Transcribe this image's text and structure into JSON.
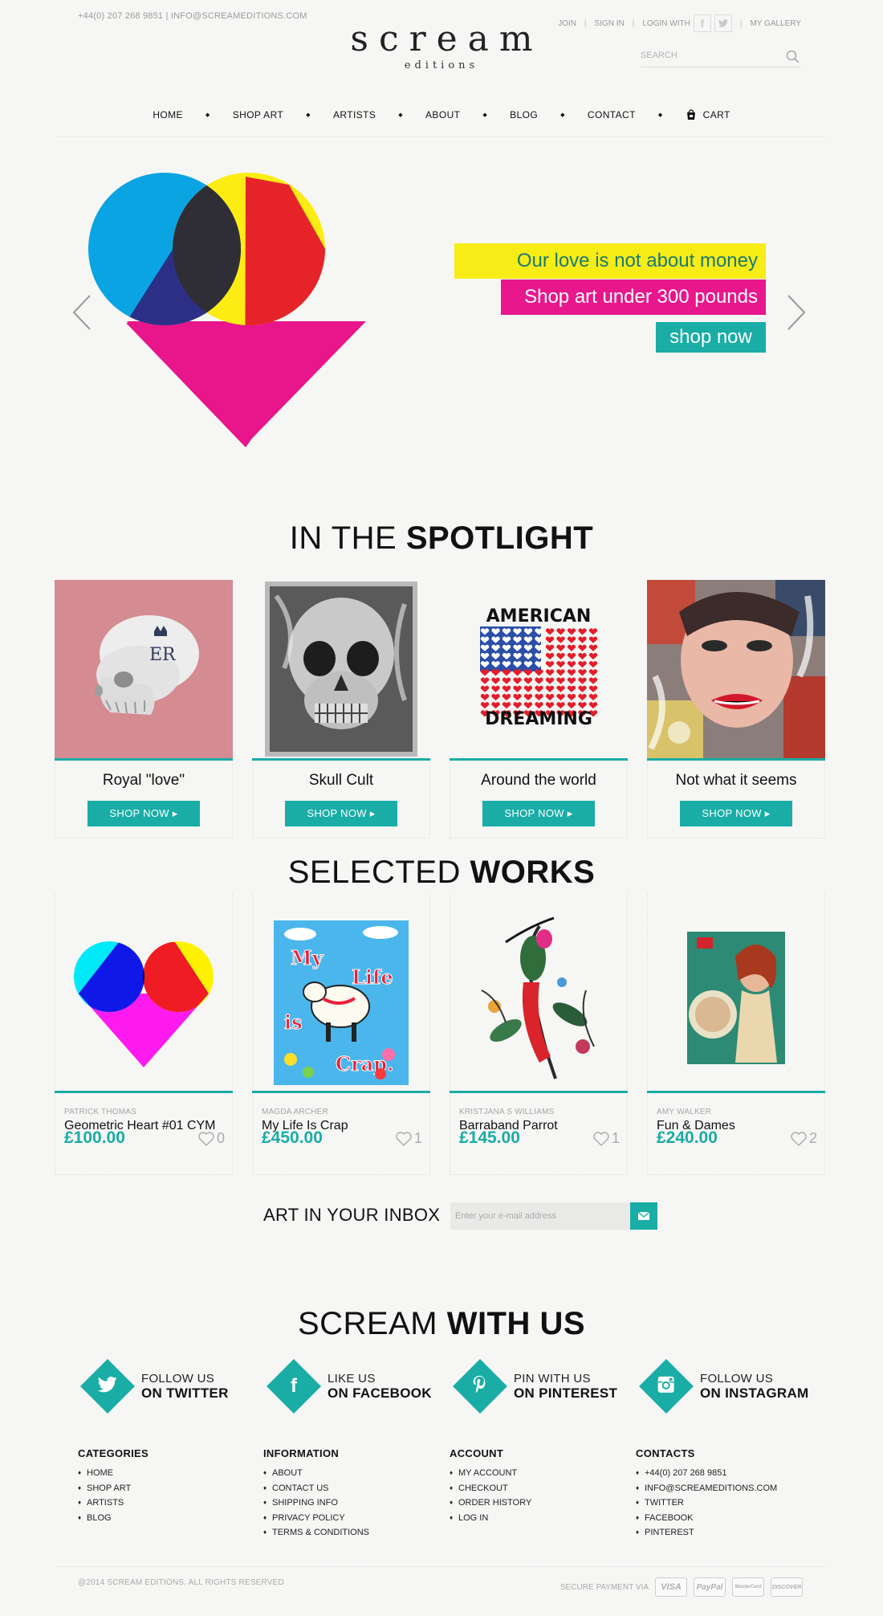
{
  "header": {
    "contact_line": "+44(0) 207 268 9851 | INFO@SCREAMEDITIONS.COM",
    "logo_main": "scream",
    "logo_sub": "editions",
    "links": {
      "join": "JOIN",
      "sign_in": "SIGN IN",
      "login_with": "LOGIN WITH",
      "my_gallery": "MY GALLERY"
    },
    "search_placeholder": "SEARCH"
  },
  "nav": {
    "home": "HOME",
    "shop_art": "SHOP ART",
    "artists": "ARTISTS",
    "about": "ABOUT",
    "blog": "BLOG",
    "contact": "CONTACT",
    "cart": "CART"
  },
  "hero": {
    "line1": "Our love is not about money",
    "line2": "Shop art under 300 pounds",
    "cta": "shop now",
    "colors": {
      "line1_bg": "#f7ec15",
      "line1_text": "#1a7a72",
      "line2_bg": "#e8178c",
      "cta_bg": "#19ada5"
    }
  },
  "spotlight": {
    "title_light": "IN THE ",
    "title_bold": "SPOTLIGHT",
    "items": [
      {
        "title": "Royal \"love\"",
        "button": "SHOP NOW ▸"
      },
      {
        "title": "Skull Cult",
        "button": "SHOP NOW ▸"
      },
      {
        "title": "Around the world",
        "button": "SHOP NOW ▸",
        "art_top": "AMERICAN",
        "art_bottom": "DREAMING"
      },
      {
        "title": "Not what it seems",
        "button": "SHOP NOW ▸"
      }
    ]
  },
  "works": {
    "title_light": "SELECTED ",
    "title_bold": "WORKS",
    "items": [
      {
        "artist": "PATRICK THOMAS",
        "title": "Geometric Heart #01 CYM",
        "price": "£100.00",
        "likes": "0"
      },
      {
        "artist": "MAGDA ARCHER",
        "title": "My Life Is Crap",
        "price": "£450.00",
        "likes": "1",
        "art_text": [
          "My",
          "Life",
          "is",
          "Crap."
        ]
      },
      {
        "artist": "KRISTJANA S WILLIAMS",
        "title": "Barraband Parrot",
        "price": "£145.00",
        "likes": "1"
      },
      {
        "artist": "AMY WALKER",
        "title": "Fun & Dames",
        "price": "£240.00",
        "likes": "2"
      }
    ]
  },
  "newsletter": {
    "label": "ART IN YOUR INBOX",
    "placeholder": "Enter your e-mail address"
  },
  "social": {
    "title_light": "SCREAM ",
    "title_bold": "WITH US",
    "items": [
      {
        "l1": "FOLLOW US",
        "l2": "ON TWITTER",
        "icon": "twitter-icon"
      },
      {
        "l1": "LIKE US",
        "l2": "ON FACEBOOK",
        "icon": "facebook-icon"
      },
      {
        "l1": "PIN WITH US",
        "l2": "ON PINTEREST",
        "icon": "pinterest-icon"
      },
      {
        "l1": "FOLLOW US",
        "l2": "ON INSTAGRAM",
        "icon": "instagram-icon"
      }
    ]
  },
  "footer": {
    "categories": {
      "title": "CATEGORIES",
      "items": [
        "HOME",
        "SHOP ART",
        "ARTISTS",
        "BLOG"
      ]
    },
    "information": {
      "title": "INFORMATION",
      "items": [
        "ABOUT",
        "CONTACT US",
        "SHIPPING INFO",
        "PRIVACY POLICY",
        "TERMS & CONDITIONS"
      ]
    },
    "account": {
      "title": "ACCOUNT",
      "items": [
        "MY ACCOUNT",
        "CHECKOUT",
        "ORDER HISTORY",
        "LOG IN"
      ]
    },
    "contacts": {
      "title": "CONTACTS",
      "items": [
        "+44(0) 207 268 9851",
        "INFO@SCREAMEDITIONS.COM",
        "TWITTER",
        "FACEBOOK",
        "PINTEREST"
      ]
    },
    "copyright": "@2014 SCREAM EDITIONS. ALL RIGHTS RESERVED",
    "payment_label": "SECURE PAYMENT VIA",
    "payments": [
      "VISA",
      "PayPal",
      "MasterCard",
      "DISCOVER"
    ]
  },
  "accent_color": "#19ada5"
}
